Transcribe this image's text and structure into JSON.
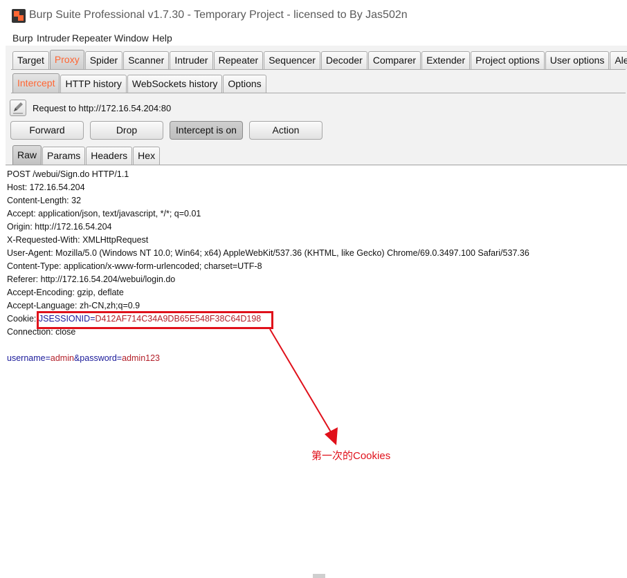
{
  "window": {
    "title": "Burp Suite Professional v1.7.30 - Temporary Project - licensed to By Jas502n"
  },
  "menu": [
    "Burp",
    "Intruder",
    "Repeater",
    "Window",
    "Help"
  ],
  "top_tabs": [
    "Target",
    "Proxy",
    "Spider",
    "Scanner",
    "Intruder",
    "Repeater",
    "Sequencer",
    "Decoder",
    "Comparer",
    "Extender",
    "Project options",
    "User options",
    "Alerts"
  ],
  "proxy_tabs": [
    "Intercept",
    "HTTP history",
    "WebSockets history",
    "Options"
  ],
  "request_label": "Request to http://172.16.54.204:80",
  "buttons": {
    "forward": "Forward",
    "drop": "Drop",
    "intercept": "Intercept is on",
    "action": "Action"
  },
  "view_tabs": [
    "Raw",
    "Params",
    "Headers",
    "Hex"
  ],
  "request": {
    "request_line": "POST /webui/Sign.do HTTP/1.1",
    "headers": [
      "Host: 172.16.54.204",
      "Content-Length: 32",
      "Accept: application/json, text/javascript, */*; q=0.01",
      "Origin: http://172.16.54.204",
      "X-Requested-With: XMLHttpRequest",
      "User-Agent: Mozilla/5.0 (Windows NT 10.0; Win64; x64) AppleWebKit/537.36 (KHTML, like Gecko) Chrome/69.0.3497.100 Safari/537.36",
      "Content-Type: application/x-www-form-urlencoded; charset=UTF-8",
      "Referer: http://172.16.54.204/webui/login.do",
      "Accept-Encoding: gzip, deflate",
      "Accept-Language: zh-CN,zh;q=0.9"
    ],
    "cookie_label": "Cookie: ",
    "cookie_name": "JSESSIONID",
    "cookie_eq": "=",
    "cookie_value": "D412AF714C34A9DB65E548F38C64D198",
    "connection": "Connection: close",
    "body": {
      "k1": "username",
      "eq1": "=",
      "v1": "admin",
      "amp": "&",
      "k2": "password",
      "eq2": "=",
      "v2": "admin123"
    }
  },
  "annotation": "第一次的Cookies",
  "colors": {
    "accent_tab": "#ff6633",
    "annotation_red": "#e0101a",
    "param_key": "#1a1a9a",
    "param_value": "#b3202a"
  }
}
